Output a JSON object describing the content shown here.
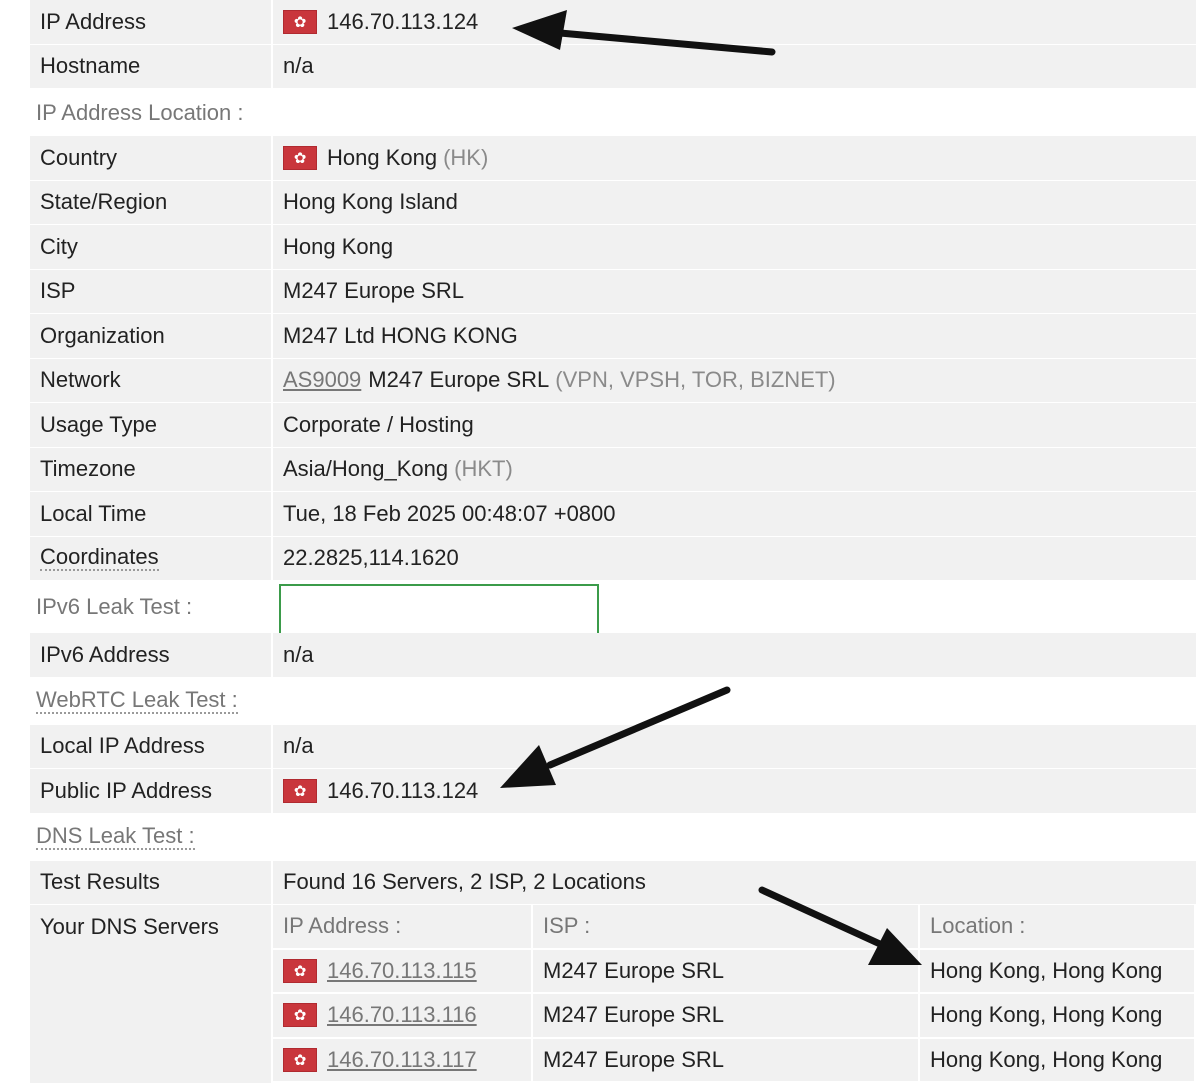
{
  "rows_top": [
    {
      "key": "IP Address",
      "value": "146.70.113.124",
      "flag": true
    },
    {
      "key": "Hostname",
      "value": "n/a"
    }
  ],
  "section_location": "IP Address Location :",
  "rows_location": [
    {
      "key": "Country",
      "value": "Hong Kong",
      "extra": "(HK)",
      "flag": true
    },
    {
      "key": "State/Region",
      "value": "Hong Kong Island"
    },
    {
      "key": "City",
      "value": "Hong Kong"
    },
    {
      "key": "ISP",
      "value": "M247 Europe SRL"
    },
    {
      "key": "Organization",
      "value": "M247 Ltd HONG KONG"
    },
    {
      "key": "Network",
      "link": "AS9009",
      "value": "M247 Europe SRL",
      "extra": "(VPN, VPSH, TOR, BIZNET)"
    },
    {
      "key": "Usage Type",
      "value": "Corporate / Hosting"
    },
    {
      "key": "Timezone",
      "value": "Asia/Hong_Kong",
      "extra": "(HKT)"
    },
    {
      "key": "Local Time",
      "value": "Tue, 18 Feb 2025 00:48:07 +0800"
    },
    {
      "key": "Coordinates",
      "value": "22.2825,114.1620"
    }
  ],
  "section_ipv6": "IPv6 Leak Test :",
  "rows_ipv6": [
    {
      "key": "IPv6 Address",
      "value": "n/a"
    }
  ],
  "section_webrtc": "WebRTC Leak Test :",
  "rows_webrtc": [
    {
      "key": "Local IP Address",
      "value": "n/a"
    },
    {
      "key": "Public IP Address",
      "value": "146.70.113.124",
      "flag": true
    }
  ],
  "section_dns": "DNS Leak Test :",
  "dns": {
    "test_results_key": "Test Results",
    "test_results_value": "Found 16 Servers, 2 ISP, 2 Locations",
    "servers_key": "Your DNS Servers",
    "col_ip": "IP Address :",
    "col_isp": "ISP :",
    "col_location": "Location :",
    "servers": [
      {
        "ip": "146.70.113.115",
        "isp": "M247 Europe SRL",
        "location": "Hong Kong, Hong Kong"
      },
      {
        "ip": "146.70.113.116",
        "isp": "M247 Europe SRL",
        "location": "Hong Kong, Hong Kong"
      },
      {
        "ip": "146.70.113.117",
        "isp": "M247 Europe SRL",
        "location": "Hong Kong, Hong Kong"
      }
    ]
  },
  "flag_glyph": "✿",
  "colors": {
    "flag": "#c9363c",
    "ipv6_box_border": "#3b9b4a",
    "row_bg": "#f1f1f1"
  }
}
